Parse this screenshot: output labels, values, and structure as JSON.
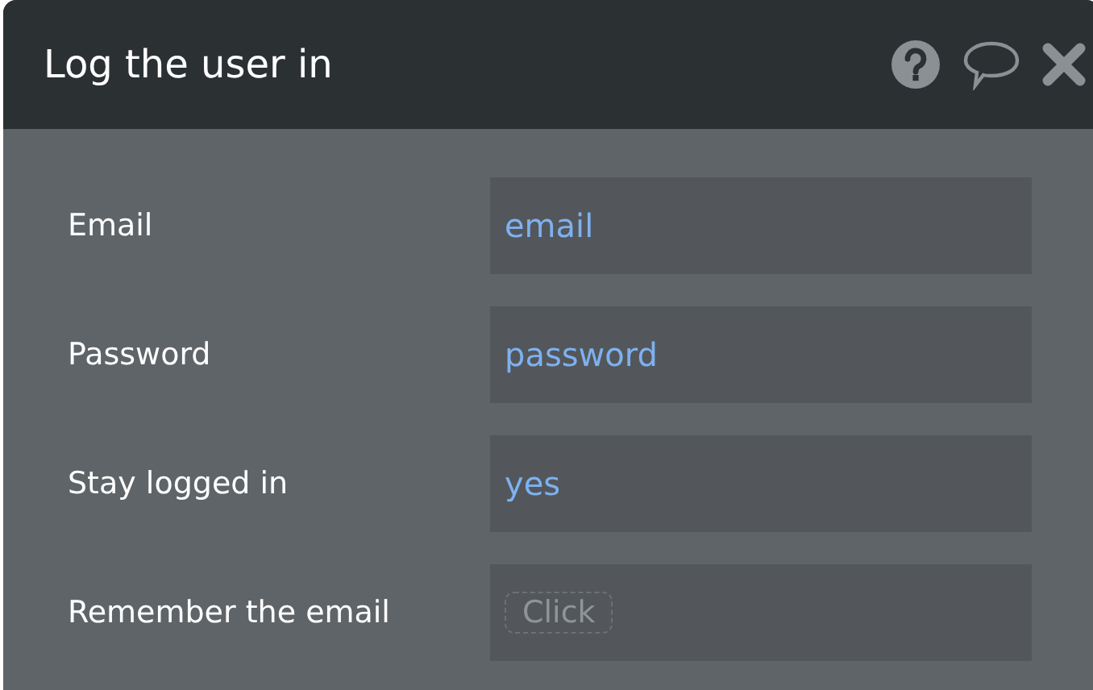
{
  "window": {
    "title": "Log the user in"
  },
  "fields": [
    {
      "label": "Email",
      "kind": "value",
      "value": "email"
    },
    {
      "label": "Password",
      "kind": "value",
      "value": "password"
    },
    {
      "label": "Stay logged in",
      "kind": "value",
      "value": "yes"
    },
    {
      "label": "Remember the email",
      "kind": "empty",
      "placeholder": "Click"
    }
  ]
}
